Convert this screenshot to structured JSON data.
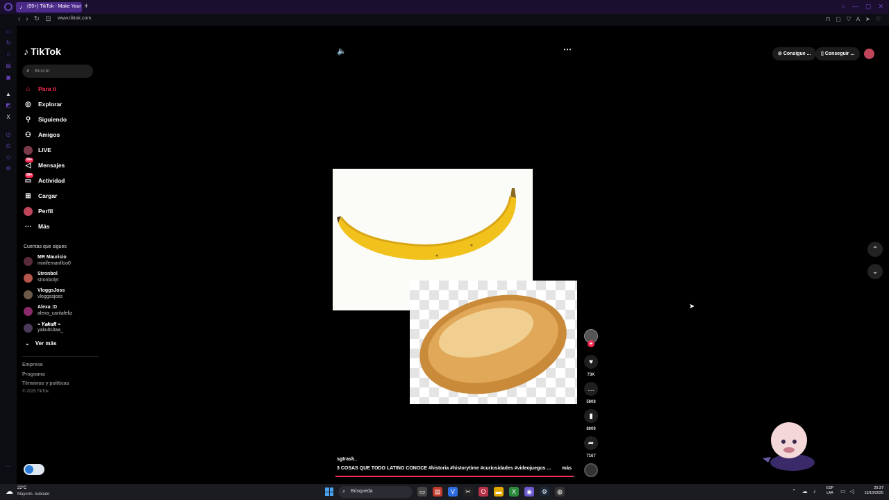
{
  "browser": {
    "tab_title": "(99+) TikTok - Make Your",
    "new_tab": "+",
    "url": "www.tiktok.com",
    "accent": "#6b46c1"
  },
  "tiktok": {
    "brand": "TikTok",
    "search": {
      "placeholder": "Buscar",
      "value": ""
    },
    "nav": [
      {
        "label": "Para ti",
        "icon": "home-icon",
        "active": true
      },
      {
        "label": "Explorar",
        "icon": "compass-icon"
      },
      {
        "label": "Siguiendo",
        "icon": "following-icon"
      },
      {
        "label": "Amigos",
        "icon": "friends-icon"
      },
      {
        "label": "LIVE",
        "icon": "live-icon"
      },
      {
        "label": "Mensajes",
        "icon": "messages-icon",
        "badge": "99+"
      },
      {
        "label": "Actividad",
        "icon": "activity-icon",
        "badge": "99+"
      },
      {
        "label": "Cargar",
        "icon": "upload-icon"
      },
      {
        "label": "Perfil",
        "icon": "profile-icon"
      },
      {
        "label": "Más",
        "icon": "more-icon"
      }
    ],
    "following": {
      "title": "Cuentas que sigues",
      "accounts": [
        {
          "name": "MR Mauricio",
          "user": "minifernanfloo0"
        },
        {
          "name": "Stronbol",
          "user": "stronbolyt"
        },
        {
          "name": "VloggsJoss",
          "user": "vloggssjoss"
        },
        {
          "name": "Alexa :D",
          "user": "alexa_caritafeliz"
        },
        {
          "name": "⌁ 𝒀𝒂𝒌𝒖𝒍𝒕 ⌁",
          "user": "yakultsitaa_"
        }
      ],
      "see_more": "Ver más"
    },
    "footer": {
      "links": [
        "Empresa",
        "Programa",
        "Términos y políticas"
      ],
      "copyright": "© 2025 TikTok"
    },
    "top_actions": {
      "coins": "Consigue ...",
      "app": "Conseguir ..."
    },
    "video": {
      "author": "sgtrash_",
      "caption": "3 COSAS QUE TODO LATINO CONOCE #historia  #historytime  #curiosidades  #videojuegos  ...",
      "more": "más",
      "progress": 0.99,
      "likes": "73K",
      "comments": "5808",
      "saves": "8009",
      "shares": "7167"
    },
    "accent": "#fe2c55"
  },
  "taskbar": {
    "weather_temp": "22°C",
    "weather_desc": "Mayorm. nublado",
    "search_label": "Búsqueda",
    "lang_line1": "ESP",
    "lang_line2": "LAA",
    "time": "20:37",
    "date": "13/10/2025"
  }
}
